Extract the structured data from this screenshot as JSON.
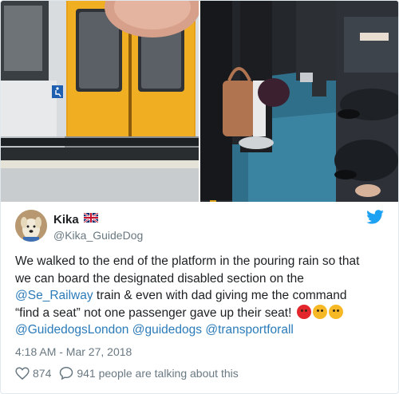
{
  "colors": {
    "link": "#2b7bb9",
    "muted": "#697882",
    "text": "#1c2022",
    "twitter_blue": "#1da1f2"
  },
  "user": {
    "name": "Kika",
    "handle": "@Kika_GuideDog",
    "flag": "uk-flag-icon"
  },
  "tweet": {
    "line1": "We walked to the end of the platform in the pouring rain so that",
    "line2": "we can board the designated disabled section on the",
    "mention1": "@Se_Railway",
    "line3_rest": " train & even with dad giving me the command",
    "line4": "“find a seat” not one passenger gave up their seat! ",
    "mention2": "@GuidedogsLondon",
    "mention3": "@guidedogs",
    "mention4": "@transportforall",
    "emojis": [
      "angry-face-icon",
      "face-with-steam-icon",
      "crying-face-icon"
    ]
  },
  "timestamp": "4:18 AM - Mar 27, 2018",
  "likes": "874",
  "talking": "941 people are talking about this"
}
